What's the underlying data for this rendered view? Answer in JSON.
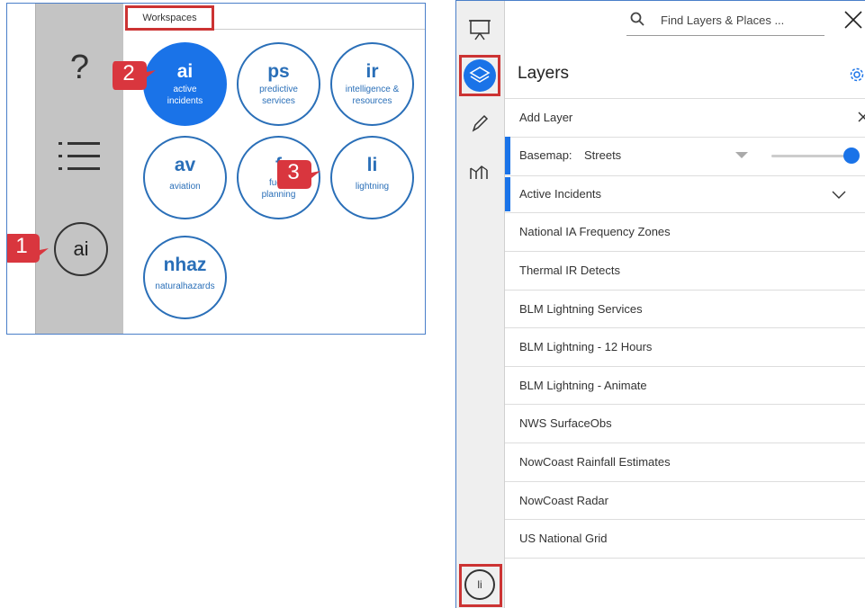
{
  "left": {
    "rail": {
      "help": "?",
      "workspace": "ai"
    },
    "workspaces_tab": "Workspaces",
    "workspaces": [
      {
        "abbr": "ai",
        "label1": "active",
        "label2": "incidents",
        "active": true
      },
      {
        "abbr": "ps",
        "label1": "predictive",
        "label2": "services",
        "active": false
      },
      {
        "abbr": "ir",
        "label1": "intelligence &",
        "label2": "resources",
        "active": false
      },
      {
        "abbr": "av",
        "label1": "aviation",
        "label2": "",
        "active": false
      },
      {
        "abbr": "f",
        "label1": "fuels",
        "label2": "planning",
        "active": false
      },
      {
        "abbr": "li",
        "label1": "lightning",
        "label2": "",
        "active": false
      },
      {
        "abbr": "nhaz",
        "label1": "naturalhazards",
        "label2": "",
        "active": false
      }
    ],
    "badges": [
      "1",
      "2",
      "3"
    ]
  },
  "right": {
    "search_placeholder": "Find Layers & Places ...",
    "title": "Layers",
    "add_layer": "Add Layer",
    "basemap_label": "Basemap:",
    "basemap_value": "Streets",
    "active_group": "Active Incidents",
    "layers": [
      "National IA Frequency Zones",
      "Thermal IR Detects",
      "BLM Lightning Services",
      "BLM Lightning - 12 Hours",
      "BLM Lightning - Animate",
      "NWS SurfaceObs",
      "NowCoast Rainfall Estimates",
      "NowCoast Radar",
      "US National Grid"
    ],
    "workspace_badge": "li",
    "colors": {
      "accent": "#1a73e8",
      "highlight": "#cc3333"
    }
  }
}
